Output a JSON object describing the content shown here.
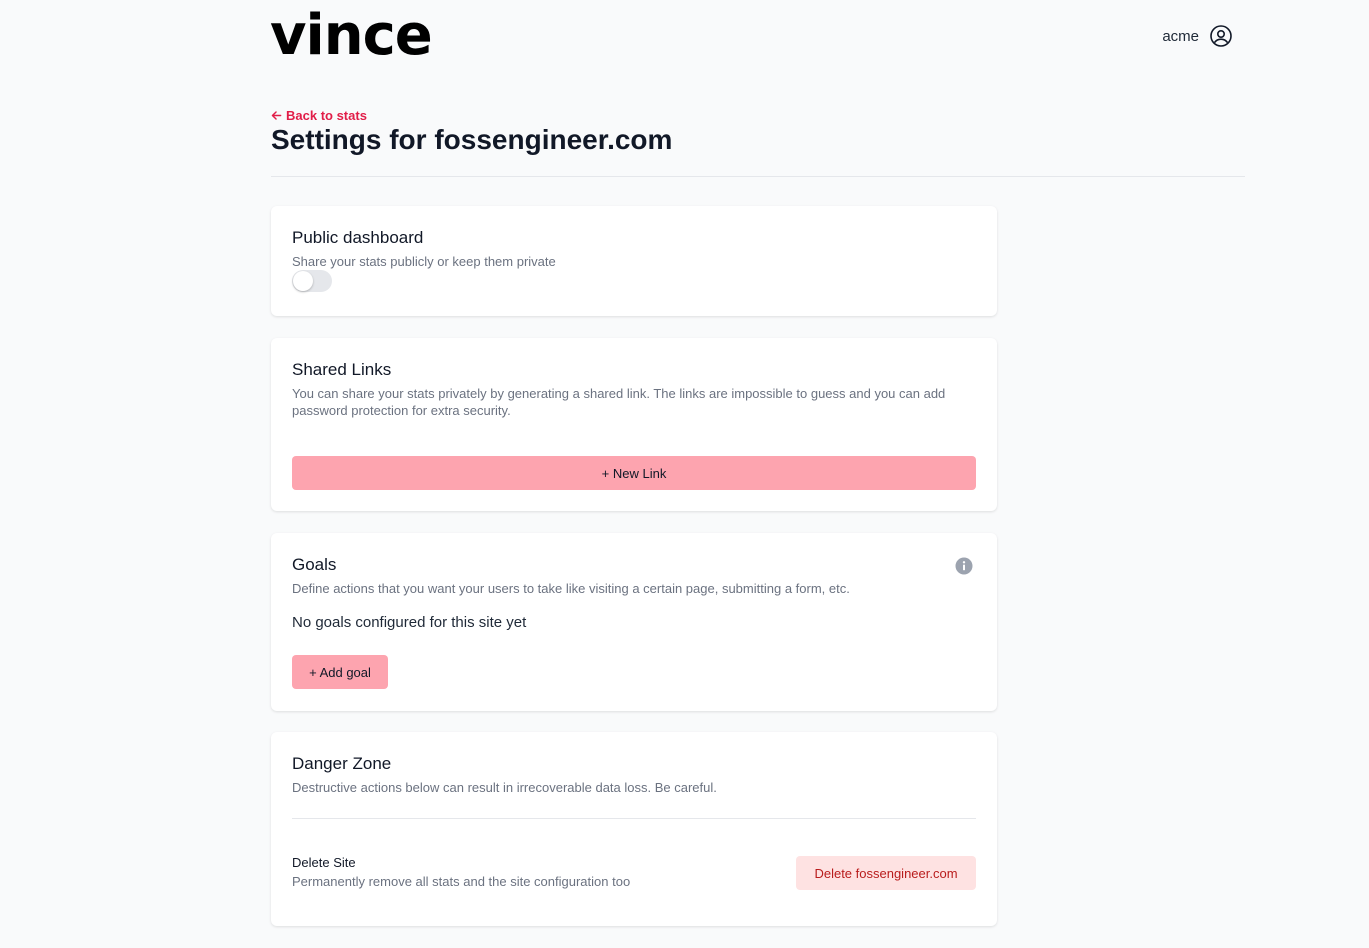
{
  "header": {
    "logo_text": "vince",
    "user_name": "acme"
  },
  "page": {
    "back_link": "Back to stats",
    "title": "Settings for fossengineer.com"
  },
  "public_dashboard": {
    "title": "Public dashboard",
    "description": "Share your stats publicly or keep them private",
    "enabled": false
  },
  "shared_links": {
    "title": "Shared Links",
    "description": "You can share your stats privately by generating a shared link. The links are impossible to guess and you can add password protection for extra security.",
    "new_link_label": "+ New Link"
  },
  "goals": {
    "title": "Goals",
    "description": "Define actions that you want your users to take like visiting a certain page, submitting a form, etc.",
    "empty_text": "No goals configured for this site yet",
    "add_label": "+ Add goal"
  },
  "danger_zone": {
    "title": "Danger Zone",
    "description": "Destructive actions below can result in irrecoverable data loss. Be careful.",
    "delete_title": "Delete Site",
    "delete_description": "Permanently remove all stats and the site configuration too",
    "delete_button": "Delete fossengineer.com"
  },
  "colors": {
    "accent": "#e11d48",
    "button_pink": "#fda4af",
    "danger_bg": "#fee2e2",
    "danger_text": "#b91c1c"
  },
  "icons": {
    "user": "user-circle-icon",
    "back": "arrow-left-icon",
    "info": "info-circle-icon"
  }
}
